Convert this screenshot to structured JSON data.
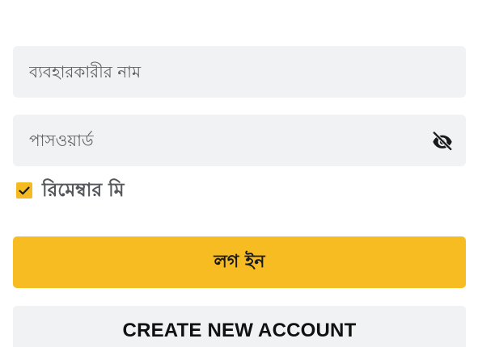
{
  "form": {
    "username": {
      "placeholder": "ব্যবহারকারীর নাম",
      "value": ""
    },
    "password": {
      "placeholder": "পাসওয়ার্ড",
      "value": "",
      "visibility_icon": "eye-off-icon"
    },
    "remember_me": {
      "label": "রিমেম্বার মি",
      "checked": true
    },
    "login_button": {
      "label": "লগ ইন"
    },
    "create_account_button": {
      "label": "CREATE NEW ACCOUNT"
    }
  },
  "colors": {
    "accent": "#f7bc22",
    "field_background": "#f1f2f4",
    "placeholder_text": "#5f6166"
  }
}
